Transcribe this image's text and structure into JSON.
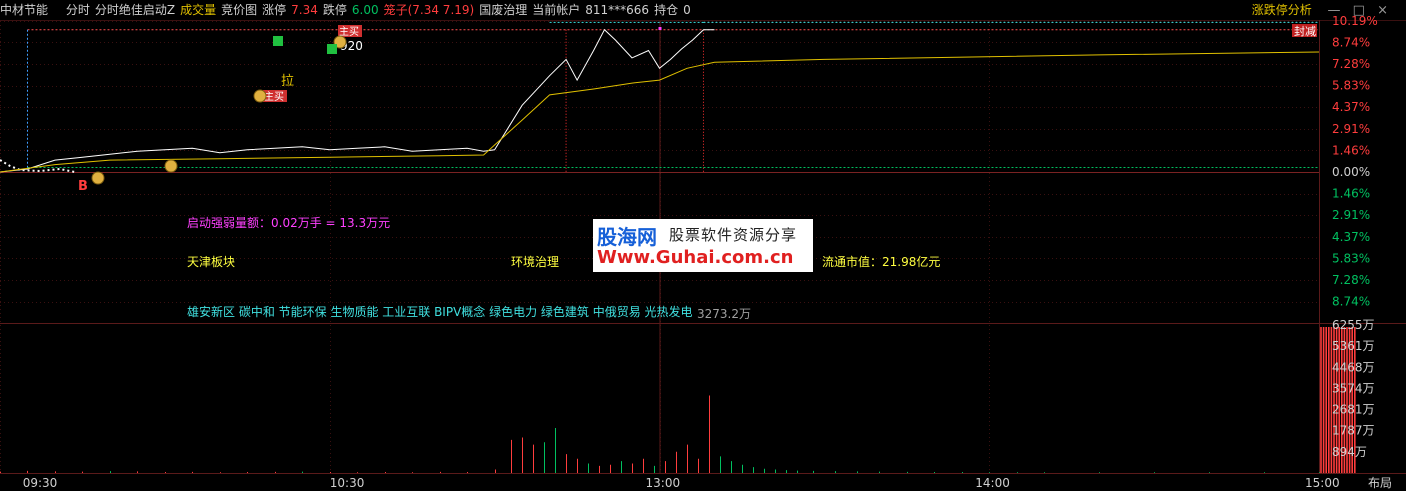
{
  "header": {
    "stock_name": "中材节能",
    "items": [
      {
        "text": "分时",
        "color": "w"
      },
      {
        "text": "分时绝佳启动Z",
        "color": "w"
      },
      {
        "text": "成交量",
        "color": "y"
      },
      {
        "text": "竞价图",
        "color": "w"
      },
      {
        "text": "涨停",
        "color": "w"
      },
      {
        "text": "7.34",
        "color": "r"
      },
      {
        "text": "跌停",
        "color": "w"
      },
      {
        "text": "6.00",
        "color": "g"
      },
      {
        "text": "笼子(7.34 7.19)",
        "color": "r"
      },
      {
        "text": "国废治理",
        "color": "w"
      },
      {
        "text": "当前帐户",
        "color": "w"
      },
      {
        "text": "811***666",
        "color": "w"
      },
      {
        "text": "持仓",
        "color": "w"
      },
      {
        "text": "0",
        "color": "w"
      }
    ],
    "right_label": "涨跌停分析",
    "window_controls": "— □ ×"
  },
  "annotations": {
    "qidong": "启动强弱量额：0.02万手 = 13.3万元",
    "sector1": "天津板块",
    "sector2": "环境治理",
    "float_mv": "流通市值：21.98亿元",
    "concepts": "雄安新区 碳中和 节能环保 生物质能 工业互联 BIPV概念 绿色电力 绿色建筑 中俄贸易 光热发电",
    "vol_label": "3273.2万",
    "fengdan": "封减",
    "num_920": "920",
    "buy_mark": "B",
    "la_mark": "拉",
    "zhuli_mark": "主买"
  },
  "watermark": {
    "site": "股海网",
    "slogan": "股票软件资源分享",
    "url": "Www.Guhai.com.cn"
  },
  "colors": {
    "background": "#000000",
    "up": "#ff3d3d",
    "down": "#00c060",
    "price_line": "#ffffff",
    "avg_line": "#e0c000",
    "magenta": "#ff40ff",
    "cyan": "#40e0e0",
    "grid": "#3a1010"
  },
  "chart_data": [
    {
      "type": "line",
      "title": "分时",
      "x_ticks": [
        "09:30",
        "10:30",
        "13:00",
        "14:00",
        "15:00"
      ],
      "right_axis_label": "布局",
      "pct_ticks_up": [
        "10.19%",
        "8.74%",
        "7.28%",
        "5.83%",
        "4.37%",
        "2.91%",
        "1.46%",
        "0.00%"
      ],
      "pct_ticks_down": [
        "1.46%",
        "2.91%",
        "4.37%",
        "5.83%",
        "7.28%",
        "8.74%"
      ],
      "ylim_pct": [
        -10.19,
        10.19
      ],
      "series": [
        {
          "name": "价格",
          "x": [
            0,
            5,
            10,
            15,
            20,
            25,
            30,
            35,
            40,
            45,
            50,
            55,
            60,
            65,
            70,
            75,
            80,
            85,
            88,
            90,
            95,
            100,
            103,
            105,
            108,
            110,
            112,
            115,
            118,
            120,
            122,
            124,
            126,
            128,
            130
          ],
          "y": [
            0.0,
            0.2,
            0.8,
            1.0,
            1.2,
            1.4,
            1.5,
            1.6,
            1.3,
            1.5,
            1.6,
            1.7,
            1.5,
            1.6,
            1.7,
            1.4,
            1.5,
            1.6,
            1.4,
            1.5,
            4.5,
            6.5,
            7.6,
            6.2,
            8.2,
            9.6,
            8.9,
            7.7,
            8.2,
            7.0,
            7.6,
            8.3,
            8.9,
            9.6,
            9.6
          ]
        },
        {
          "name": "均价",
          "x": [
            0,
            10,
            20,
            40,
            60,
            80,
            88,
            95,
            100,
            108,
            115,
            120,
            125,
            130,
            150,
            200,
            240
          ],
          "y": [
            0.0,
            0.5,
            0.8,
            0.9,
            1.0,
            1.1,
            1.15,
            3.5,
            5.2,
            5.6,
            6.0,
            6.2,
            7.0,
            7.4,
            7.6,
            7.9,
            8.1
          ]
        }
      ]
    },
    {
      "type": "bar",
      "title": "成交量",
      "y_ticks": [
        "6255万",
        "5361万",
        "4468万",
        "3574万",
        "2681万",
        "1787万",
        "894万"
      ],
      "ylim": [
        0,
        6255
      ],
      "unit": "万",
      "peak_label": "3273.2万",
      "values": [
        {
          "x": 0,
          "v": 60,
          "up": true
        },
        {
          "x": 5,
          "v": 90,
          "up": true
        },
        {
          "x": 10,
          "v": 70,
          "up": true
        },
        {
          "x": 15,
          "v": 60,
          "up": true
        },
        {
          "x": 20,
          "v": 80,
          "up": false
        },
        {
          "x": 25,
          "v": 70,
          "up": true
        },
        {
          "x": 30,
          "v": 40,
          "up": true
        },
        {
          "x": 35,
          "v": 50,
          "up": true
        },
        {
          "x": 40,
          "v": 30,
          "up": true
        },
        {
          "x": 45,
          "v": 40,
          "up": true
        },
        {
          "x": 50,
          "v": 50,
          "up": true
        },
        {
          "x": 55,
          "v": 60,
          "up": false
        },
        {
          "x": 60,
          "v": 40,
          "up": true
        },
        {
          "x": 65,
          "v": 30,
          "up": true
        },
        {
          "x": 70,
          "v": 40,
          "up": true
        },
        {
          "x": 75,
          "v": 30,
          "up": true
        },
        {
          "x": 80,
          "v": 50,
          "up": true
        },
        {
          "x": 85,
          "v": 40,
          "up": true
        },
        {
          "x": 90,
          "v": 150,
          "up": true
        },
        {
          "x": 93,
          "v": 1400,
          "up": true
        },
        {
          "x": 95,
          "v": 1500,
          "up": true
        },
        {
          "x": 97,
          "v": 1200,
          "up": true
        },
        {
          "x": 99,
          "v": 1300,
          "up": false
        },
        {
          "x": 101,
          "v": 1900,
          "up": false
        },
        {
          "x": 103,
          "v": 800,
          "up": true
        },
        {
          "x": 105,
          "v": 600,
          "up": true
        },
        {
          "x": 107,
          "v": 400,
          "up": false
        },
        {
          "x": 109,
          "v": 300,
          "up": true
        },
        {
          "x": 111,
          "v": 350,
          "up": true
        },
        {
          "x": 113,
          "v": 500,
          "up": false
        },
        {
          "x": 115,
          "v": 400,
          "up": true
        },
        {
          "x": 117,
          "v": 600,
          "up": true
        },
        {
          "x": 119,
          "v": 300,
          "up": false
        },
        {
          "x": 121,
          "v": 500,
          "up": true
        },
        {
          "x": 123,
          "v": 900,
          "up": true
        },
        {
          "x": 125,
          "v": 1200,
          "up": true
        },
        {
          "x": 127,
          "v": 600,
          "up": true
        },
        {
          "x": 129,
          "v": 3273.2,
          "up": true
        },
        {
          "x": 131,
          "v": 700,
          "up": false
        },
        {
          "x": 133,
          "v": 500,
          "up": false
        },
        {
          "x": 135,
          "v": 350,
          "up": false
        },
        {
          "x": 137,
          "v": 250,
          "up": false
        },
        {
          "x": 139,
          "v": 180,
          "up": false
        },
        {
          "x": 141,
          "v": 150,
          "up": false
        },
        {
          "x": 143,
          "v": 120,
          "up": false
        },
        {
          "x": 145,
          "v": 100,
          "up": false
        },
        {
          "x": 148,
          "v": 90,
          "up": false
        },
        {
          "x": 152,
          "v": 80,
          "up": false
        },
        {
          "x": 156,
          "v": 70,
          "up": false
        },
        {
          "x": 160,
          "v": 60,
          "up": false
        },
        {
          "x": 165,
          "v": 50,
          "up": false
        },
        {
          "x": 170,
          "v": 40,
          "up": false
        },
        {
          "x": 175,
          "v": 40,
          "up": false
        },
        {
          "x": 180,
          "v": 30,
          "up": false
        },
        {
          "x": 185,
          "v": 30,
          "up": false
        },
        {
          "x": 190,
          "v": 30,
          "up": false
        },
        {
          "x": 200,
          "v": 30,
          "up": false
        },
        {
          "x": 210,
          "v": 30,
          "up": false
        },
        {
          "x": 220,
          "v": 30,
          "up": false
        },
        {
          "x": 230,
          "v": 30,
          "up": false
        },
        {
          "x": 240,
          "v": 30,
          "up": false
        }
      ],
      "auction_side": {
        "v": 6255,
        "up": true
      }
    }
  ]
}
